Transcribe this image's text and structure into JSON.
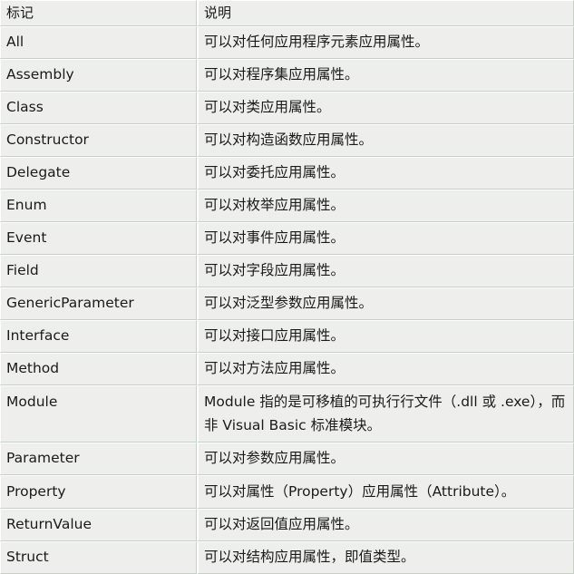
{
  "table": {
    "headers": {
      "tag": "标记",
      "description": "说明"
    },
    "rows": [
      {
        "tag": "All",
        "description": "可以对任何应用程序元素应用属性。"
      },
      {
        "tag": "Assembly",
        "description": "可以对程序集应用属性。"
      },
      {
        "tag": "Class",
        "description": "可以对类应用属性。"
      },
      {
        "tag": "Constructor",
        "description": "可以对构造函数应用属性。"
      },
      {
        "tag": "Delegate",
        "description": "可以对委托应用属性。"
      },
      {
        "tag": "Enum",
        "description": "可以对枚举应用属性。"
      },
      {
        "tag": "Event",
        "description": "可以对事件应用属性。"
      },
      {
        "tag": "Field",
        "description": "可以对字段应用属性。"
      },
      {
        "tag": "GenericParameter",
        "description": "可以对泛型参数应用属性。"
      },
      {
        "tag": "Interface",
        "description": "可以对接口应用属性。"
      },
      {
        "tag": "Method",
        "description": "可以对方法应用属性。"
      },
      {
        "tag": "Module",
        "description": "Module 指的是可移植的可执行行文件（.dll 或 .exe），而非 Visual Basic 标准模块。"
      },
      {
        "tag": "Parameter",
        "description": "可以对参数应用属性。"
      },
      {
        "tag": "Property",
        "description": "可以对属性（Property）应用属性（Attribute）。"
      },
      {
        "tag": "ReturnValue",
        "description": "可以对返回值应用属性。"
      },
      {
        "tag": "Struct",
        "description": "可以对结构应用属性，即值类型。"
      }
    ]
  },
  "colors": {
    "cell_background": "#eeefed",
    "cell_border": "#c8cec8",
    "cell_highlight": "#ffffff",
    "text": "#1a1a1a",
    "page_background": "#ffffff"
  }
}
